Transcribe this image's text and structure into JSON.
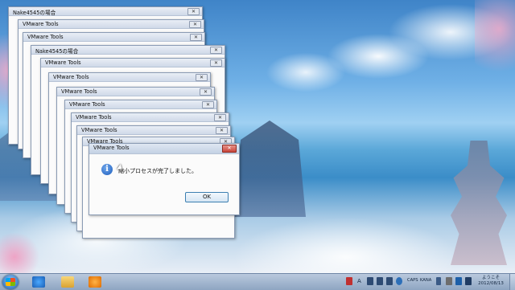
{
  "windows": [
    {
      "title": "Nake4545の場合",
      "close": "✕"
    },
    {
      "title": "VMware Tools",
      "close": "✕"
    },
    {
      "title": "VMware Tools",
      "close": "✕"
    },
    {
      "title": "Nake4545の場合",
      "close": "✕"
    },
    {
      "title": "VMware Tools",
      "close": "✕"
    },
    {
      "title": "VMware Tools",
      "close": "✕"
    },
    {
      "title": "VMware Tools",
      "close": "✕"
    },
    {
      "title": "VMware Tools",
      "close": "✕"
    },
    {
      "title": "VMware Tools",
      "close": "✕"
    },
    {
      "title": "VMware Tools",
      "close": "✕"
    },
    {
      "title": "VMware Tools",
      "close": "✕"
    }
  ],
  "dialog": {
    "title": "VMware Tools",
    "close": "✕",
    "icon": "i",
    "message": "縮小プロセスが完了しました。",
    "ok_label": "OK"
  },
  "taskbar": {
    "tray_lang": "A",
    "tray_text1": "CAPS",
    "tray_text2": "KANA",
    "clock_time": "ようこそ",
    "clock_date": "2012/08/13"
  },
  "colors": {
    "accent": "#3c7fb1",
    "close_red": "#c8443a",
    "taskbar": "#8ea5c2"
  }
}
